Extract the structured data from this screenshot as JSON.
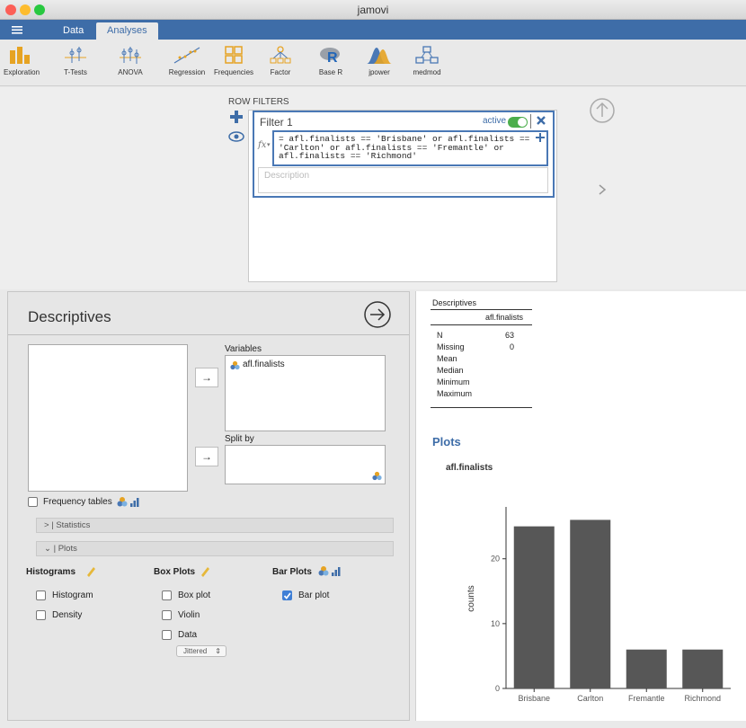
{
  "window": {
    "title": "jamovi"
  },
  "menubar": {
    "menu_icon": "hamburger-icon",
    "tabs": [
      {
        "label": "Data"
      },
      {
        "label": "Analyses"
      }
    ]
  },
  "ribbon": {
    "items": [
      {
        "label": "Exploration",
        "icon": "exploration-icon"
      },
      {
        "label": "T-Tests",
        "icon": "ttests-icon"
      },
      {
        "label": "ANOVA",
        "icon": "anova-icon"
      },
      {
        "label": "Regression",
        "icon": "regression-icon"
      },
      {
        "label": "Frequencies",
        "icon": "frequencies-icon"
      },
      {
        "label": "Factor",
        "icon": "factor-icon"
      },
      {
        "label": "Base R",
        "icon": "base-r-icon"
      },
      {
        "label": "jpower",
        "icon": "jpower-icon"
      },
      {
        "label": "medmod",
        "icon": "medmod-icon"
      }
    ]
  },
  "row_filters": {
    "heading": "ROW FILTERS",
    "filter_name": "Filter 1",
    "active_label": "active",
    "expression_lines": [
      "= afl.finalists == 'Brisbane' or afl.finalists ==",
      "'Carlton' or afl.finalists == 'Fremantle' or",
      "afl.finalists == 'Richmond'"
    ],
    "fx_label": "fx",
    "description_placeholder": "Description"
  },
  "descriptives_panel": {
    "title": "Descriptives",
    "variables_label": "Variables",
    "variable_item": "afl.finalists",
    "split_by_label": "Split by",
    "frequency_tables_label": "Frequency tables",
    "statistics_label": "Statistics",
    "plots_label": "Plots",
    "histograms_heading": "Histograms",
    "histogram_label": "Histogram",
    "density_label": "Density",
    "boxplots_heading": "Box Plots",
    "boxplot_label": "Box plot",
    "violin_label": "Violin",
    "data_label": "Data",
    "jitter_value": "Jittered",
    "barplots_heading": "Bar Plots",
    "barplot_label": "Bar plot"
  },
  "results": {
    "table_title": "Descriptives",
    "column_header": "afl.finalists",
    "rows": [
      {
        "label": "N",
        "value": "63"
      },
      {
        "label": "Missing",
        "value": "0"
      },
      {
        "label": "Mean",
        "value": ""
      },
      {
        "label": "Median",
        "value": ""
      },
      {
        "label": "Minimum",
        "value": ""
      },
      {
        "label": "Maximum",
        "value": ""
      }
    ],
    "plots_heading": "Plots",
    "plot_title": "afl.finalists"
  },
  "colors": {
    "accent": "#3e6da8",
    "bar_fill": "#575757",
    "toggle_green": "#4cae4c"
  },
  "chart_data": {
    "type": "bar",
    "title": "afl.finalists",
    "categories": [
      "Brisbane",
      "Carlton",
      "Fremantle",
      "Richmond"
    ],
    "values": [
      25,
      26,
      6,
      6
    ],
    "xlabel": "",
    "ylabel": "counts",
    "ylim": [
      0,
      28
    ],
    "yticks": [
      0,
      10,
      20
    ],
    "grid": false
  }
}
